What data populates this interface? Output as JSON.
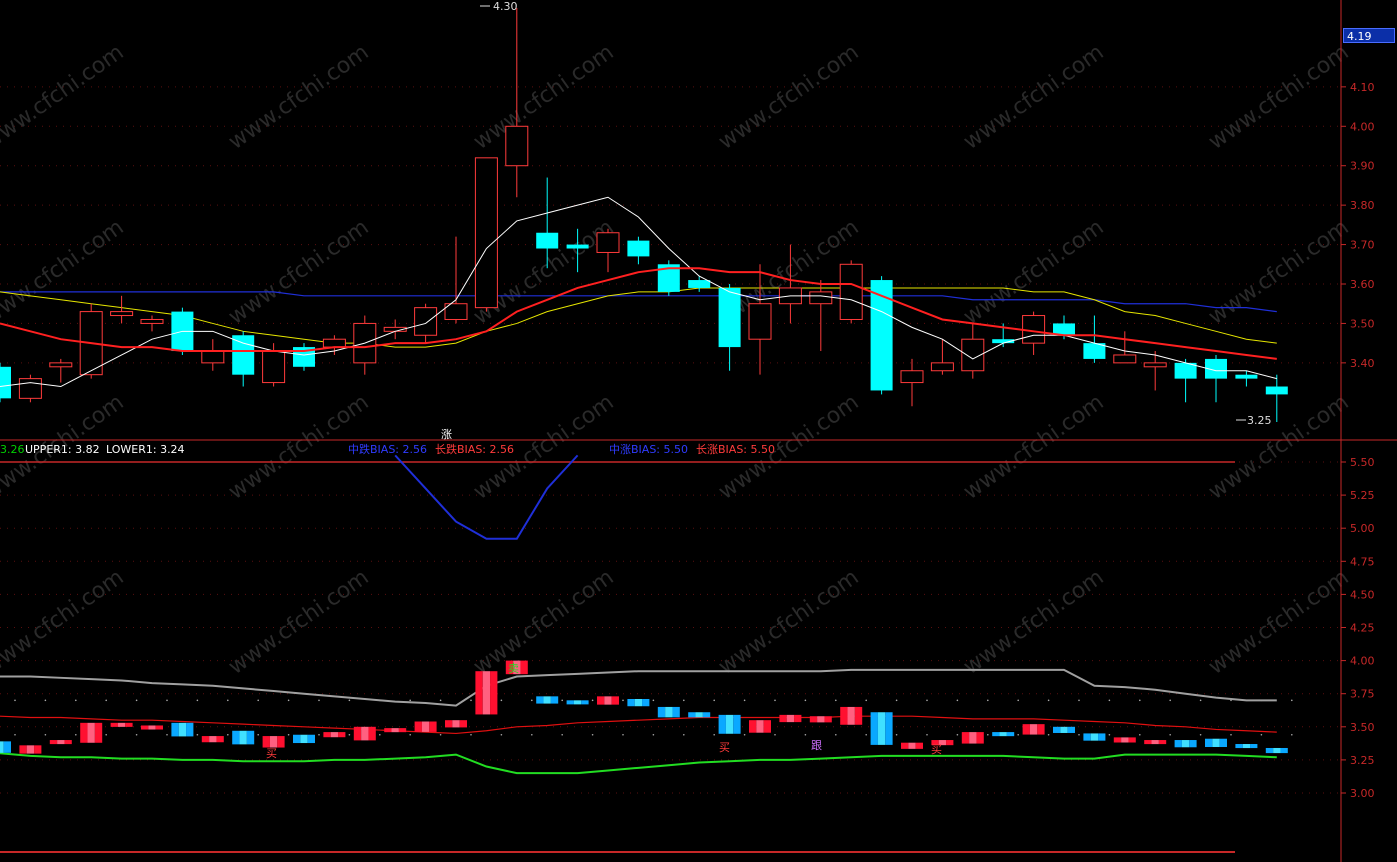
{
  "price_tag": "4.19",
  "info_line": {
    "seg0": "3.26",
    "upper": "UPPER1: 3.82",
    "lower": "LOWER1: 3.24",
    "bias_down_mid": "中跌BIAS: 2.56",
    "bias_down_long": "长跌BIAS: 2.56",
    "bias_up_mid": "中涨BIAS: 5.50",
    "bias_up_long": "长涨BIAS: 5.50"
  },
  "annotations": {
    "high": "4.30",
    "low": "3.25",
    "rise": "涨",
    "sell": "卖",
    "buy1": "买",
    "buy2": "买",
    "buy3": "买",
    "follow": "跟"
  },
  "watermark": "www.cfchi.com",
  "colors": {
    "up": "#ff3b3b",
    "down": "#00ffff",
    "ma_short": "#ffffff",
    "ma_mid": "#ff2020",
    "ma_yellow": "#e6e600",
    "ma_blue": "#1f2fd8",
    "axis": "#c62828"
  },
  "chart_data": [
    {
      "type": "candlestick",
      "yaxis_ticks": [
        "4.10",
        "4.00",
        "3.90",
        "3.80",
        "3.70",
        "3.60",
        "3.50",
        "3.40"
      ],
      "ylim": [
        3.2,
        4.3
      ],
      "candles": [
        {
          "o": 3.39,
          "c": 3.31,
          "h": 3.4,
          "l": 3.3
        },
        {
          "o": 3.31,
          "c": 3.36,
          "h": 3.37,
          "l": 3.3
        },
        {
          "o": 3.39,
          "c": 3.4,
          "h": 3.41,
          "l": 3.35
        },
        {
          "o": 3.37,
          "c": 3.53,
          "h": 3.55,
          "l": 3.36
        },
        {
          "o": 3.52,
          "c": 3.53,
          "h": 3.57,
          "l": 3.5
        },
        {
          "o": 3.5,
          "c": 3.51,
          "h": 3.52,
          "l": 3.48
        },
        {
          "o": 3.53,
          "c": 3.43,
          "h": 3.54,
          "l": 3.42
        },
        {
          "o": 3.4,
          "c": 3.43,
          "h": 3.46,
          "l": 3.38
        },
        {
          "o": 3.47,
          "c": 3.37,
          "h": 3.48,
          "l": 3.34
        },
        {
          "o": 3.35,
          "c": 3.43,
          "h": 3.45,
          "l": 3.34
        },
        {
          "o": 3.44,
          "c": 3.39,
          "h": 3.45,
          "l": 3.38
        },
        {
          "o": 3.44,
          "c": 3.46,
          "h": 3.47,
          "l": 3.42
        },
        {
          "o": 3.4,
          "c": 3.5,
          "h": 3.52,
          "l": 3.37
        },
        {
          "o": 3.48,
          "c": 3.49,
          "h": 3.51,
          "l": 3.46
        },
        {
          "o": 3.47,
          "c": 3.54,
          "h": 3.55,
          "l": 3.45
        },
        {
          "o": 3.51,
          "c": 3.55,
          "h": 3.72,
          "l": 3.5
        },
        {
          "o": 3.54,
          "c": 3.92,
          "h": 3.92,
          "l": 3.53
        },
        {
          "o": 3.9,
          "c": 4.0,
          "h": 4.3,
          "l": 3.82
        },
        {
          "o": 3.73,
          "c": 3.69,
          "h": 3.87,
          "l": 3.64
        },
        {
          "o": 3.7,
          "c": 3.69,
          "h": 3.74,
          "l": 3.63
        },
        {
          "o": 3.68,
          "c": 3.73,
          "h": 3.74,
          "l": 3.63
        },
        {
          "o": 3.71,
          "c": 3.67,
          "h": 3.72,
          "l": 3.65
        },
        {
          "o": 3.65,
          "c": 3.58,
          "h": 3.66,
          "l": 3.57
        },
        {
          "o": 3.61,
          "c": 3.59,
          "h": 3.62,
          "l": 3.58
        },
        {
          "o": 3.59,
          "c": 3.44,
          "h": 3.6,
          "l": 3.38
        },
        {
          "o": 3.46,
          "c": 3.55,
          "h": 3.65,
          "l": 3.37
        },
        {
          "o": 3.55,
          "c": 3.59,
          "h": 3.7,
          "l": 3.5
        },
        {
          "o": 3.55,
          "c": 3.58,
          "h": 3.61,
          "l": 3.43
        },
        {
          "o": 3.51,
          "c": 3.65,
          "h": 3.66,
          "l": 3.5
        },
        {
          "o": 3.61,
          "c": 3.33,
          "h": 3.62,
          "l": 3.32
        },
        {
          "o": 3.35,
          "c": 3.38,
          "h": 3.41,
          "l": 3.29
        },
        {
          "o": 3.38,
          "c": 3.4,
          "h": 3.46,
          "l": 3.37
        },
        {
          "o": 3.38,
          "c": 3.46,
          "h": 3.5,
          "l": 3.36
        },
        {
          "o": 3.46,
          "c": 3.45,
          "h": 3.5,
          "l": 3.44
        },
        {
          "o": 3.45,
          "c": 3.52,
          "h": 3.53,
          "l": 3.42
        },
        {
          "o": 3.5,
          "c": 3.47,
          "h": 3.52,
          "l": 3.46
        },
        {
          "o": 3.45,
          "c": 3.41,
          "h": 3.52,
          "l": 3.4
        },
        {
          "o": 3.4,
          "c": 3.42,
          "h": 3.48,
          "l": 3.4
        },
        {
          "o": 3.39,
          "c": 3.4,
          "h": 3.43,
          "l": 3.33
        },
        {
          "o": 3.4,
          "c": 3.36,
          "h": 3.41,
          "l": 3.3
        },
        {
          "o": 3.41,
          "c": 3.36,
          "h": 3.42,
          "l": 3.3
        },
        {
          "o": 3.37,
          "c": 3.36,
          "h": 3.38,
          "l": 3.34
        },
        {
          "o": 3.34,
          "c": 3.32,
          "h": 3.37,
          "l": 3.25
        }
      ],
      "ma_short": [
        3.34,
        3.35,
        3.34,
        3.38,
        3.42,
        3.46,
        3.48,
        3.48,
        3.45,
        3.43,
        3.42,
        3.43,
        3.45,
        3.48,
        3.5,
        3.56,
        3.69,
        3.76,
        3.78,
        3.8,
        3.82,
        3.77,
        3.69,
        3.62,
        3.58,
        3.56,
        3.57,
        3.57,
        3.56,
        3.53,
        3.49,
        3.46,
        3.41,
        3.45,
        3.47,
        3.47,
        3.45,
        3.43,
        3.42,
        3.4,
        3.38,
        3.38,
        3.36
      ],
      "ma_mid": [
        3.5,
        3.48,
        3.46,
        3.45,
        3.44,
        3.44,
        3.43,
        3.43,
        3.43,
        3.43,
        3.43,
        3.44,
        3.44,
        3.45,
        3.45,
        3.46,
        3.48,
        3.53,
        3.56,
        3.59,
        3.61,
        3.63,
        3.64,
        3.64,
        3.63,
        3.63,
        3.61,
        3.6,
        3.6,
        3.57,
        3.54,
        3.51,
        3.5,
        3.49,
        3.48,
        3.47,
        3.47,
        3.46,
        3.45,
        3.44,
        3.43,
        3.42,
        3.41
      ],
      "ma_yellow": [
        3.58,
        3.57,
        3.56,
        3.55,
        3.54,
        3.53,
        3.52,
        3.5,
        3.48,
        3.47,
        3.46,
        3.45,
        3.45,
        3.44,
        3.44,
        3.45,
        3.48,
        3.5,
        3.53,
        3.55,
        3.57,
        3.58,
        3.58,
        3.59,
        3.59,
        3.59,
        3.59,
        3.59,
        3.59,
        3.59,
        3.59,
        3.59,
        3.59,
        3.59,
        3.58,
        3.58,
        3.56,
        3.53,
        3.52,
        3.5,
        3.48,
        3.46,
        3.45
      ],
      "ma_blue": [
        3.58,
        3.58,
        3.58,
        3.58,
        3.58,
        3.58,
        3.58,
        3.58,
        3.58,
        3.58,
        3.57,
        3.57,
        3.57,
        3.57,
        3.57,
        3.57,
        3.57,
        3.57,
        3.57,
        3.57,
        3.57,
        3.57,
        3.57,
        3.57,
        3.57,
        3.57,
        3.57,
        3.57,
        3.57,
        3.57,
        3.57,
        3.57,
        3.56,
        3.56,
        3.56,
        3.56,
        3.56,
        3.55,
        3.55,
        3.55,
        3.54,
        3.54,
        3.53
      ]
    },
    {
      "type": "indicator",
      "yaxis_ticks": [
        "5.50",
        "5.25",
        "5.00",
        "4.75",
        "4.50",
        "4.25",
        "4.00",
        "3.75",
        "3.50",
        "3.25",
        "3.00"
      ],
      "ylim": [
        2.8,
        5.6
      ],
      "band_upper": [
        3.88,
        3.88,
        3.87,
        3.86,
        3.85,
        3.83,
        3.82,
        3.81,
        3.79,
        3.77,
        3.75,
        3.73,
        3.71,
        3.69,
        3.68,
        3.66,
        3.81,
        3.88,
        3.89,
        3.9,
        3.91,
        3.92,
        3.92,
        3.92,
        3.92,
        3.92,
        3.92,
        3.92,
        3.93,
        3.93,
        3.93,
        3.93,
        3.93,
        3.93,
        3.93,
        3.93,
        3.81,
        3.8,
        3.78,
        3.75,
        3.72,
        3.7,
        3.7
      ],
      "band_mid": [
        3.58,
        3.57,
        3.57,
        3.56,
        3.55,
        3.55,
        3.54,
        3.53,
        3.52,
        3.51,
        3.5,
        3.49,
        3.48,
        3.47,
        3.46,
        3.45,
        3.47,
        3.5,
        3.51,
        3.53,
        3.54,
        3.55,
        3.56,
        3.57,
        3.57,
        3.57,
        3.57,
        3.57,
        3.58,
        3.58,
        3.58,
        3.57,
        3.56,
        3.56,
        3.56,
        3.55,
        3.54,
        3.53,
        3.51,
        3.5,
        3.48,
        3.47,
        3.46
      ],
      "band_lower": [
        3.3,
        3.28,
        3.27,
        3.27,
        3.26,
        3.26,
        3.25,
        3.25,
        3.24,
        3.24,
        3.24,
        3.25,
        3.25,
        3.26,
        3.27,
        3.29,
        3.2,
        3.15,
        3.15,
        3.15,
        3.17,
        3.19,
        3.21,
        3.23,
        3.24,
        3.25,
        3.25,
        3.26,
        3.27,
        3.28,
        3.28,
        3.28,
        3.28,
        3.28,
        3.27,
        3.26,
        3.26,
        3.29,
        3.29,
        3.29,
        3.29,
        3.28,
        3.27
      ],
      "bias_line": [
        5.55,
        5.3,
        5.05,
        4.92,
        4.92,
        5.3,
        5.55
      ],
      "bias_index_start": 13
    }
  ]
}
